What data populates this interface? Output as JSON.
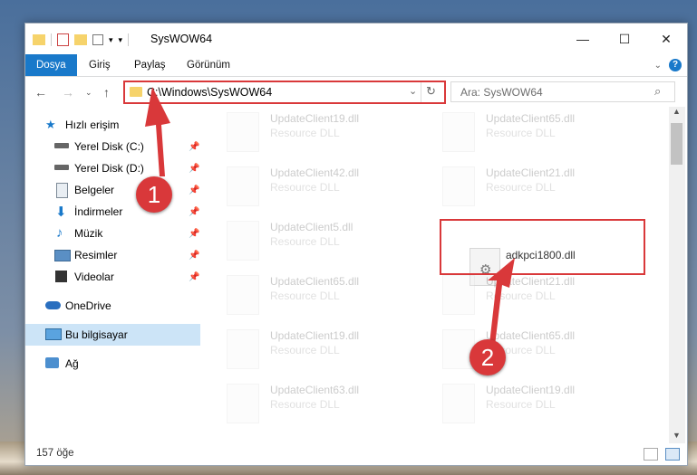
{
  "window": {
    "title": "SysWOW64",
    "minimize": "—",
    "maximize": "☐",
    "close": "✕"
  },
  "ribbon": {
    "tabs": [
      "Dosya",
      "Giriş",
      "Paylaş",
      "Görünüm"
    ],
    "expand_icon": "chevron-down-icon",
    "help_label": "?"
  },
  "address": {
    "path": "C:\\Windows\\SysWOW64",
    "search_placeholder": "Ara: SysWOW64"
  },
  "nav": {
    "quick_access": "Hızlı erişim",
    "items": [
      {
        "label": "Yerel Disk (C:)",
        "icon": "drive-icon"
      },
      {
        "label": "Yerel Disk (D:)",
        "icon": "drive-icon"
      },
      {
        "label": "Belgeler",
        "icon": "documents-icon"
      },
      {
        "label": "İndirmeler",
        "icon": "downloads-icon"
      },
      {
        "label": "Müzik",
        "icon": "music-icon"
      },
      {
        "label": "Resimler",
        "icon": "pictures-icon"
      },
      {
        "label": "Videolar",
        "icon": "videos-icon"
      }
    ],
    "onedrive": "OneDrive",
    "this_pc": "Bu bilgisayar",
    "network": "Ağ"
  },
  "files": [
    {
      "name": "UpdateClient19.dll",
      "type": "Resource DLL"
    },
    {
      "name": "UpdateClient65.dll",
      "type": "Resource DLL"
    },
    {
      "name": "UpdateClient42.dll",
      "type": "Resource DLL"
    },
    {
      "name": "UpdateClient21.dll",
      "type": "Resource DLL"
    },
    {
      "name": "UpdateClient5.dll",
      "type": "Resource DLL"
    },
    {
      "name": "adkpci1800.dll",
      "type": ""
    },
    {
      "name": "UpdateClient65.dll",
      "type": "Resource DLL"
    },
    {
      "name": "UpdateClient21.dll",
      "type": "Resource DLL"
    },
    {
      "name": "UpdateClient19.dll",
      "type": "Resource DLL"
    },
    {
      "name": "UpdateClient65.dll",
      "type": "Resource DLL"
    },
    {
      "name": "UpdateClient63.dll",
      "type": "Resource DLL"
    },
    {
      "name": "UpdateClient19.dll",
      "type": "Resource DLL"
    }
  ],
  "status": {
    "count": "157 öğe"
  },
  "annotations": {
    "step1": "1",
    "step2": "2",
    "color": "#d9383a"
  }
}
